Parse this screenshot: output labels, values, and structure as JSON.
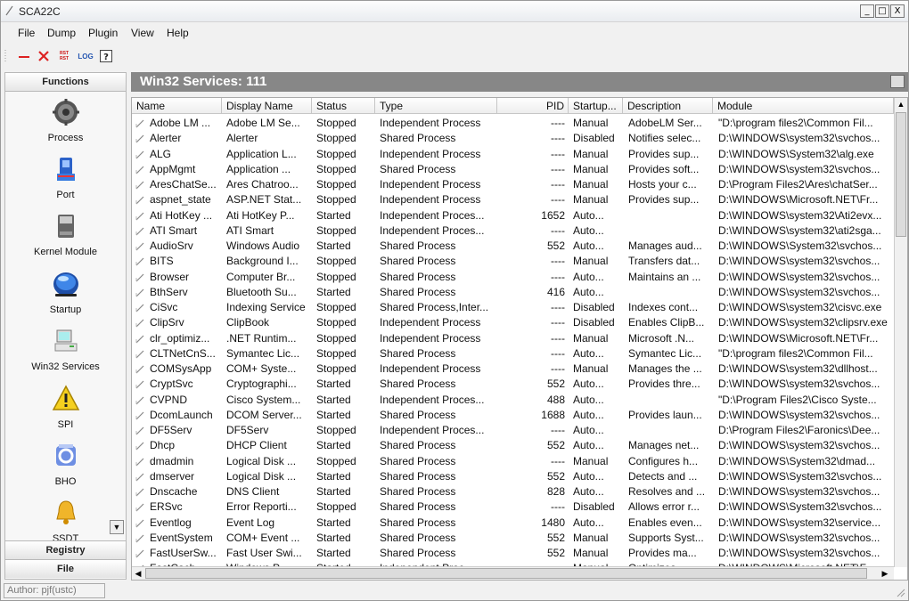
{
  "window": {
    "title": "SCA22C",
    "controls": [
      "_",
      "□",
      "X"
    ]
  },
  "menu": [
    "File",
    "Dump",
    "Plugin",
    "View",
    "Help"
  ],
  "toolbar": {
    "log_label": "LOG",
    "rst_label_top": "RST",
    "rst_label_bottom": "RST"
  },
  "sidebar": {
    "header": "Functions",
    "items": [
      {
        "label": "Process",
        "icon": "gear-icon"
      },
      {
        "label": "Port",
        "icon": "port-icon"
      },
      {
        "label": "Kernel Module",
        "icon": "disk-icon"
      },
      {
        "label": "Startup",
        "icon": "globe-icon"
      },
      {
        "label": "Win32 Services",
        "icon": "computer-icon"
      },
      {
        "label": "SPI",
        "icon": "warning-icon"
      },
      {
        "label": "BHO",
        "icon": "bho-icon"
      },
      {
        "label": "SSDT",
        "icon": "bell-icon"
      }
    ],
    "footer_registry": "Registry",
    "footer_file": "File"
  },
  "panel": {
    "title": "Win32 Services:",
    "count": "111"
  },
  "columns": [
    "Name",
    "Display Name",
    "Status",
    "Type",
    "PID",
    "Startup...",
    "Description",
    "Module"
  ],
  "rows": [
    [
      "Adobe LM ...",
      "Adobe LM Se...",
      "Stopped",
      "Independent Process",
      "----",
      "Manual",
      "AdobeLM Ser...",
      "\"D:\\program files2\\Common Fil..."
    ],
    [
      "Alerter",
      "Alerter",
      "Stopped",
      "Shared Process",
      "----",
      "Disabled",
      "Notifies selec...",
      "D:\\WINDOWS\\system32\\svchos..."
    ],
    [
      "ALG",
      "Application L...",
      "Stopped",
      "Independent Process",
      "----",
      "Manual",
      "Provides sup...",
      "D:\\WINDOWS\\System32\\alg.exe"
    ],
    [
      "AppMgmt",
      "Application ...",
      "Stopped",
      "Shared Process",
      "----",
      "Manual",
      "Provides soft...",
      "D:\\WINDOWS\\system32\\svchos..."
    ],
    [
      "AresChatSe...",
      "Ares Chatroo...",
      "Stopped",
      "Independent Process",
      "----",
      "Manual",
      "Hosts your c...",
      "D:\\Program Files2\\Ares\\chatSer..."
    ],
    [
      "aspnet_state",
      "ASP.NET Stat...",
      "Stopped",
      "Independent Process",
      "----",
      "Manual",
      "Provides sup...",
      "D:\\WINDOWS\\Microsoft.NET\\Fr..."
    ],
    [
      "Ati HotKey ...",
      "Ati HotKey P...",
      "Started",
      "Independent Proces...",
      "1652",
      "Auto...",
      "",
      "D:\\WINDOWS\\system32\\Ati2evx..."
    ],
    [
      "ATI Smart",
      "ATI Smart",
      "Stopped",
      "Independent Proces...",
      "----",
      "Auto...",
      "",
      "D:\\WINDOWS\\system32\\ati2sga..."
    ],
    [
      "AudioSrv",
      "Windows Audio",
      "Started",
      "Shared Process",
      "552",
      "Auto...",
      "Manages aud...",
      "D:\\WINDOWS\\System32\\svchos..."
    ],
    [
      "BITS",
      "Background I...",
      "Stopped",
      "Shared Process",
      "----",
      "Manual",
      "Transfers dat...",
      "D:\\WINDOWS\\system32\\svchos..."
    ],
    [
      "Browser",
      "Computer Br...",
      "Stopped",
      "Shared Process",
      "----",
      "Auto...",
      "Maintains an ...",
      "D:\\WINDOWS\\system32\\svchos..."
    ],
    [
      "BthServ",
      "Bluetooth Su...",
      "Started",
      "Shared Process",
      "416",
      "Auto...",
      "",
      "D:\\WINDOWS\\system32\\svchos..."
    ],
    [
      "CiSvc",
      "Indexing Service",
      "Stopped",
      "Shared Process,Inter...",
      "----",
      "Disabled",
      "Indexes cont...",
      "D:\\WINDOWS\\system32\\cisvc.exe"
    ],
    [
      "ClipSrv",
      "ClipBook",
      "Stopped",
      "Independent Process",
      "----",
      "Disabled",
      "Enables ClipB...",
      "D:\\WINDOWS\\system32\\clipsrv.exe"
    ],
    [
      "clr_optimiz...",
      ".NET Runtim...",
      "Stopped",
      "Independent Process",
      "----",
      "Manual",
      "Microsoft .N...",
      "D:\\WINDOWS\\Microsoft.NET\\Fr..."
    ],
    [
      "CLTNetCnS...",
      "Symantec Lic...",
      "Stopped",
      "Shared Process",
      "----",
      "Auto...",
      "Symantec Lic...",
      "\"D:\\program files2\\Common Fil..."
    ],
    [
      "COMSysApp",
      "COM+ Syste...",
      "Stopped",
      "Independent Process",
      "----",
      "Manual",
      "Manages the ...",
      "D:\\WINDOWS\\system32\\dllhost..."
    ],
    [
      "CryptSvc",
      "Cryptographi...",
      "Started",
      "Shared Process",
      "552",
      "Auto...",
      "Provides thre...",
      "D:\\WINDOWS\\system32\\svchos..."
    ],
    [
      "CVPND",
      "Cisco System...",
      "Started",
      "Independent Proces...",
      "488",
      "Auto...",
      "",
      "\"D:\\Program Files2\\Cisco Syste..."
    ],
    [
      "DcomLaunch",
      "DCOM Server...",
      "Started",
      "Shared Process",
      "1688",
      "Auto...",
      "Provides laun...",
      "D:\\WINDOWS\\system32\\svchos..."
    ],
    [
      "DF5Serv",
      "DF5Serv",
      "Stopped",
      "Independent Proces...",
      "----",
      "Auto...",
      "",
      "D:\\Program Files2\\Faronics\\Dee..."
    ],
    [
      "Dhcp",
      "DHCP Client",
      "Started",
      "Shared Process",
      "552",
      "Auto...",
      "Manages net...",
      "D:\\WINDOWS\\system32\\svchos..."
    ],
    [
      "dmadmin",
      "Logical Disk ...",
      "Stopped",
      "Shared Process",
      "----",
      "Manual",
      "Configures h...",
      "D:\\WINDOWS\\System32\\dmad..."
    ],
    [
      "dmserver",
      "Logical Disk ...",
      "Started",
      "Shared Process",
      "552",
      "Auto...",
      "Detects and ...",
      "D:\\WINDOWS\\System32\\svchos..."
    ],
    [
      "Dnscache",
      "DNS Client",
      "Started",
      "Shared Process",
      "828",
      "Auto...",
      "Resolves and ...",
      "D:\\WINDOWS\\system32\\svchos..."
    ],
    [
      "ERSvc",
      "Error Reporti...",
      "Stopped",
      "Shared Process",
      "----",
      "Disabled",
      "Allows error r...",
      "D:\\WINDOWS\\System32\\svchos..."
    ],
    [
      "Eventlog",
      "Event Log",
      "Started",
      "Shared Process",
      "1480",
      "Auto...",
      "Enables even...",
      "D:\\WINDOWS\\system32\\service..."
    ],
    [
      "EventSystem",
      "COM+ Event ...",
      "Started",
      "Shared Process",
      "552",
      "Manual",
      "Supports Syst...",
      "D:\\WINDOWS\\system32\\svchos..."
    ],
    [
      "FastUserSw...",
      "Fast User Swi...",
      "Started",
      "Shared Process",
      "552",
      "Manual",
      "Provides ma...",
      "D:\\WINDOWS\\system32\\svchos..."
    ],
    [
      "FastCach...",
      "Windows P...",
      "Started",
      "Independent Proc...",
      "----",
      "Manual",
      "Optimizes...",
      "D:\\WINDOWS\\Microsoft.NET\\F..."
    ]
  ],
  "status": {
    "author": "Author: pjf(ustc)"
  }
}
